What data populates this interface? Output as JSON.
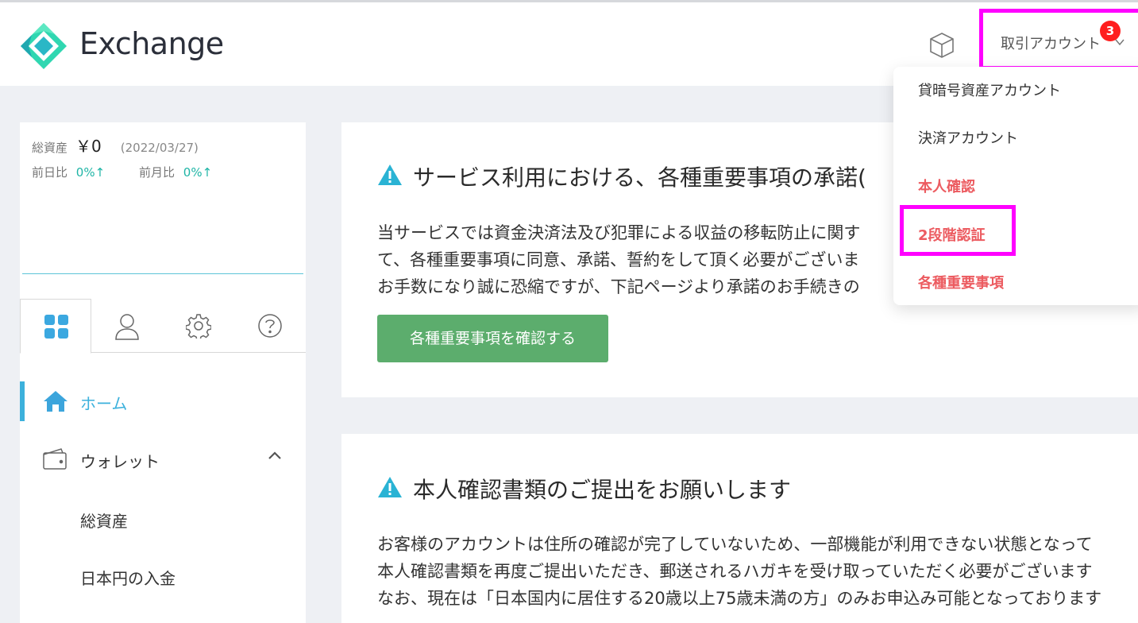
{
  "header": {
    "brand": "Exchange",
    "account_label": "取引アカウント",
    "badge_count": "3",
    "icons": [
      "exchange-logo-icon",
      "cube-icon",
      "chevron-down-icon"
    ]
  },
  "sidebar": {
    "total_assets_label": "総資産",
    "total_assets_value": "￥0",
    "date": "(2022/03/27)",
    "prev_day_label": "前日比",
    "prev_day_value": "0%↑",
    "prev_month_label": "前月比",
    "prev_month_value": "0%↑",
    "tabs": [
      "grid-icon",
      "user-icon",
      "gear-icon",
      "help-icon"
    ],
    "nav": {
      "home": "ホーム",
      "wallet": "ウォレット",
      "sub_total_assets": "総資産",
      "sub_jpy_deposit": "日本円の入金"
    }
  },
  "card1": {
    "title": "サービス利用における、各種重要事項の承諾(",
    "lines": [
      "当サービスでは資金決済法及び犯罪による収益の移転防止に関す",
      "て、各種重要事項に同意、承諾、誓約をして頂く必要がございま",
      "お手数になり誠に恐縮ですが、下記ページより承諾のお手続きの"
    ],
    "button": "各種重要事項を確認する"
  },
  "card2": {
    "title": "本人確認書類のご提出をお願いします",
    "lines": [
      "お客様のアカウントは住所の確認が完了していないため、一部機能が利用できない状態となって",
      "本人確認書類を再度ご提出いただき、郵送されるハガキを受け取っていただく必要がございます",
      "なお、現在は「日本国内に居住する20歳以上75歳未満の方」のみお申込み可能となっております"
    ]
  },
  "dropdown": {
    "items": [
      "貸暗号資産アカウント",
      "決済アカウント",
      "本人確認",
      "2段階認証",
      "各種重要事項"
    ]
  },
  "colors": {
    "accent": "#3cb1dc",
    "green_button": "#5cad6d",
    "alert_red": "#ec5b60",
    "highlight": "#ff00ff",
    "positive": "#1fb5a6"
  }
}
